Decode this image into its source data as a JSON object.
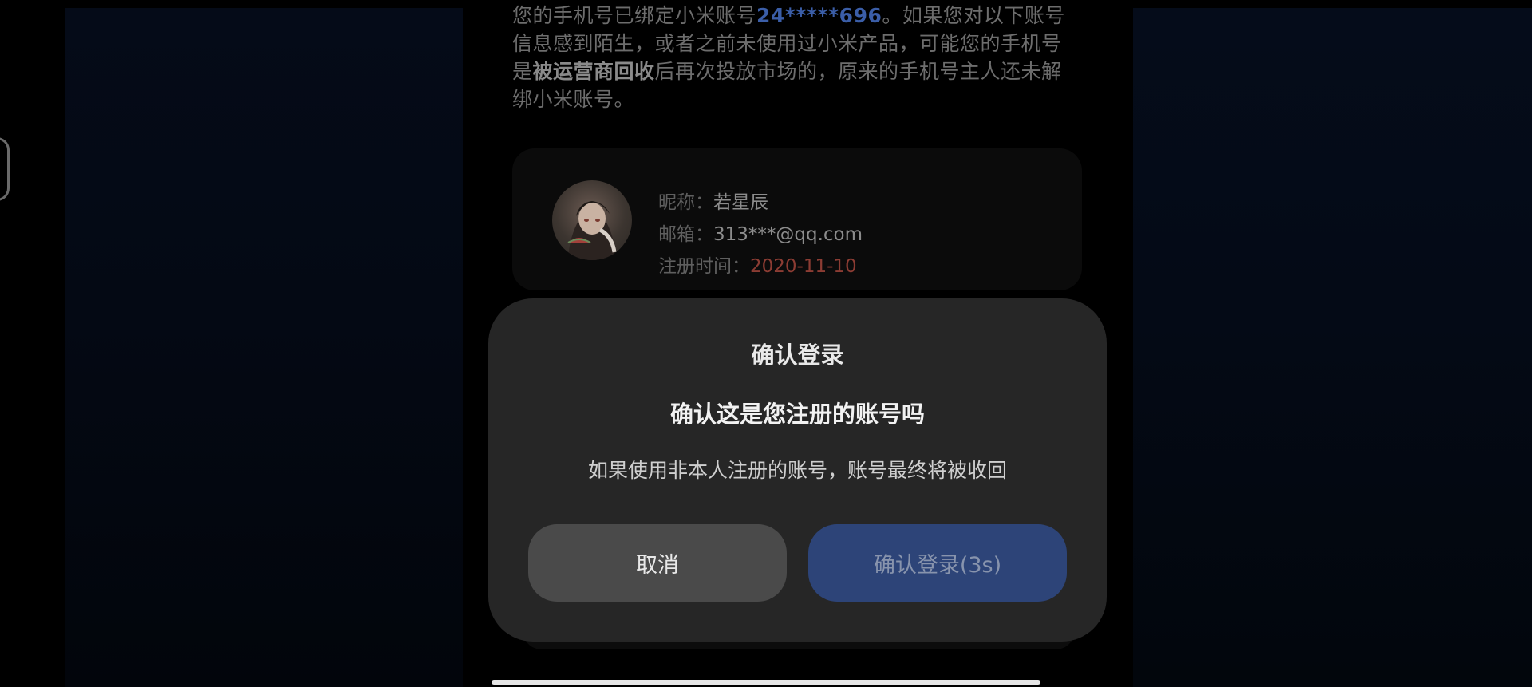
{
  "intro": {
    "part1": "您的手机号已绑定小米账号",
    "masked_account": "24*****696",
    "part2": "。如果您对以下账号信息感到陌生，或者之前未使用过小米产品，可能您的手机号是",
    "emphasis": "被运营商回收",
    "part3": "后再次投放市场的，原来的手机号主人还未解绑小米账号。"
  },
  "account": {
    "nickname_label": "昵称：",
    "nickname": "若星辰",
    "email_label": "邮箱：",
    "email": "313***@qq.com",
    "register_label": "注册时间：",
    "register_date": "2020-11-10",
    "avatar_icon": "avatar-image"
  },
  "dialog": {
    "title": "确认登录",
    "question": "确认这是您注册的账号吗",
    "warning": "如果使用非本人注册的账号，账号最终将被收回",
    "cancel_label": "取消",
    "confirm_label": "确认登录(3s)"
  },
  "colors": {
    "accent_blue": "#3b5ea8",
    "confirm_button": "#2d4478",
    "date_red": "#8c3c33",
    "dialog_bg": "#262626"
  }
}
